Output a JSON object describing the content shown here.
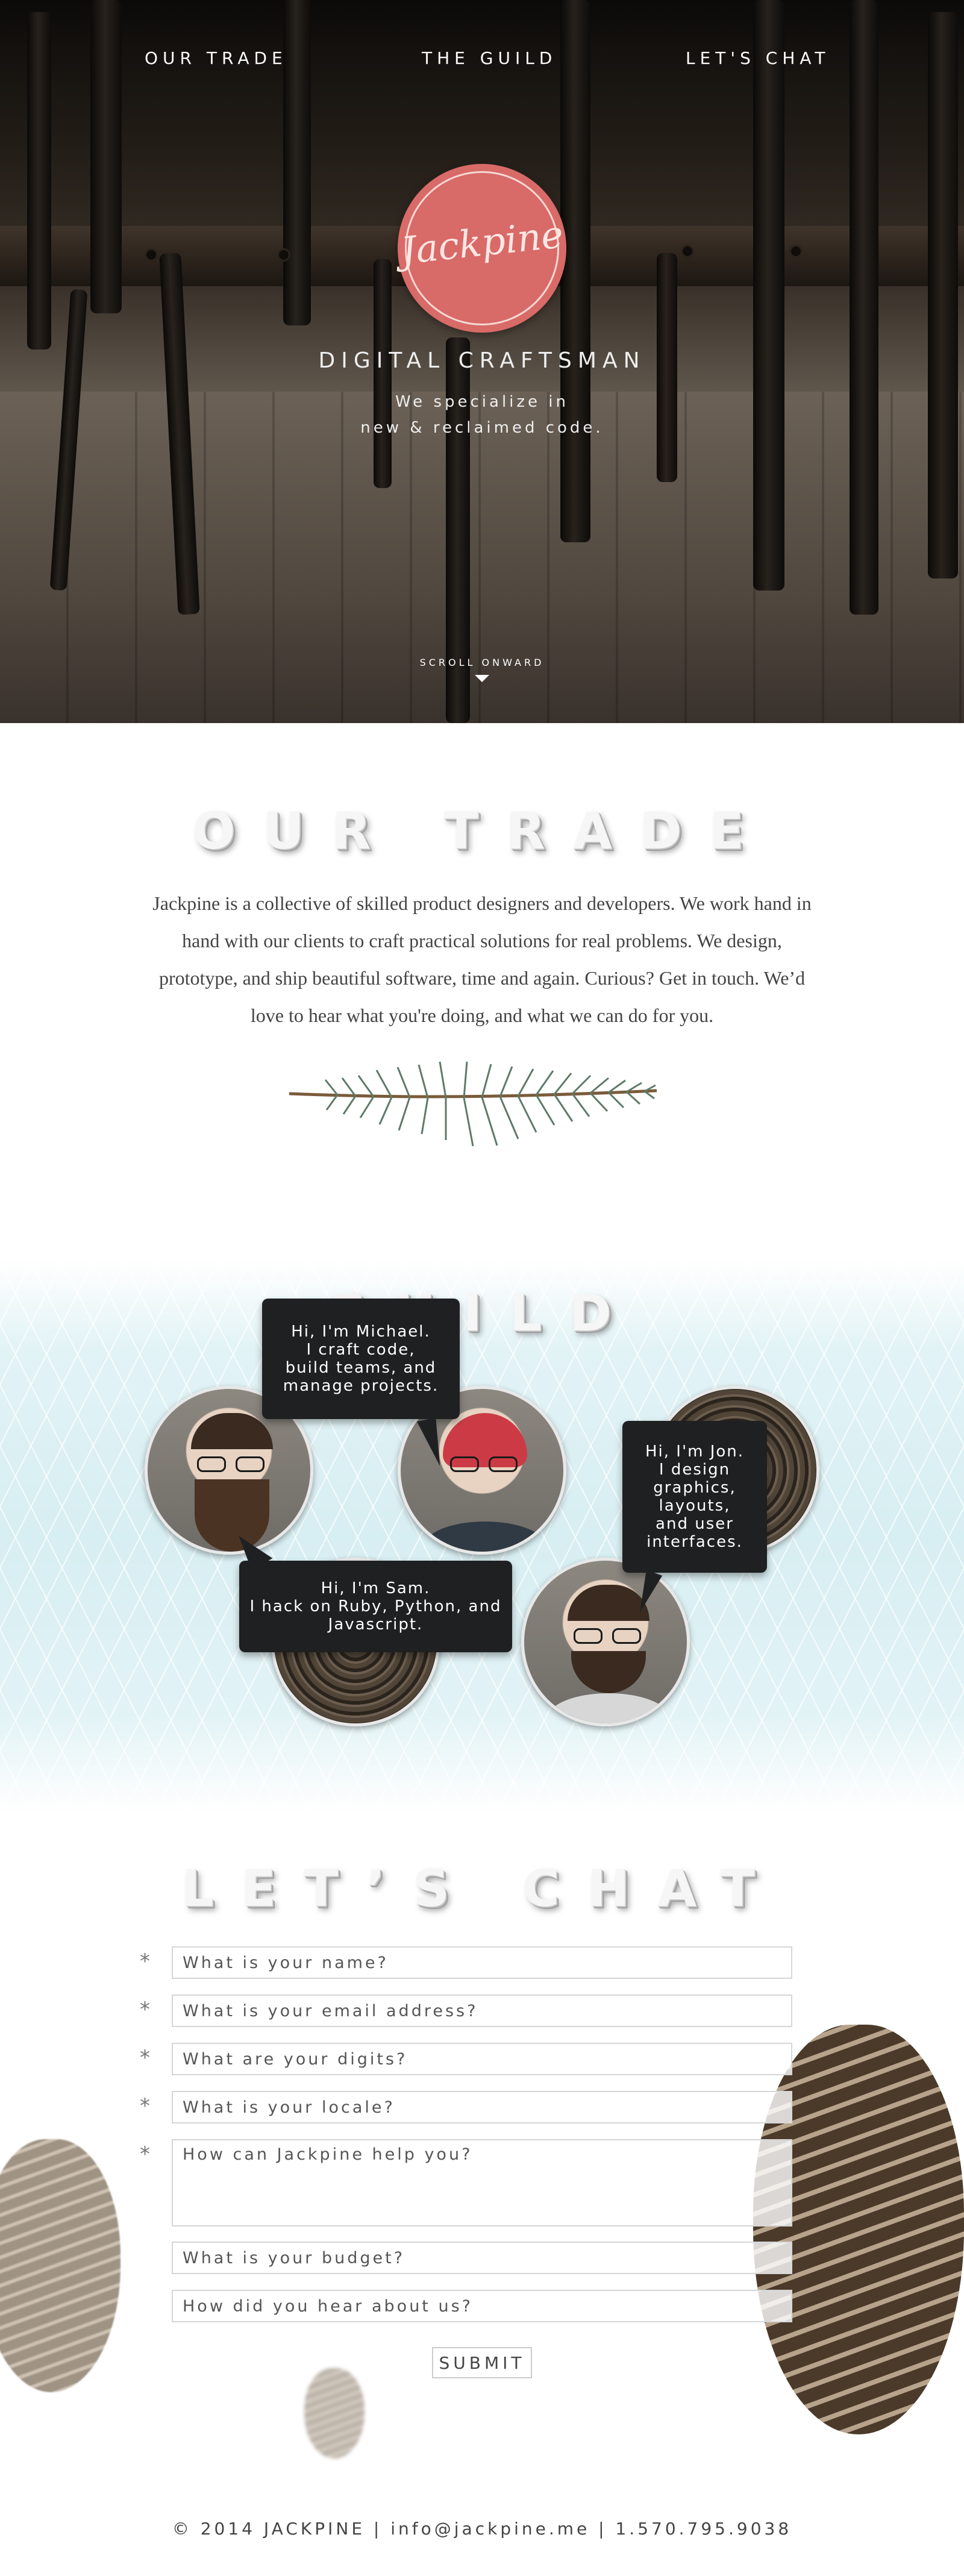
{
  "nav": {
    "trade": "OUR TRADE",
    "guild": "THE GUILD",
    "chat": "LET'S CHAT"
  },
  "hero": {
    "logo_text": "Jackpine",
    "tagline": "DIGITAL CRAFTSMAN",
    "sub_line1": "We specialize in",
    "sub_line2": "new & reclaimed code.",
    "scroll": "SCROLL ONWARD"
  },
  "trade": {
    "heading": "OUR TRADE",
    "body": "Jackpine is a collective of skilled product designers and developers. We work hand in hand with our clients to craft practical solutions for real problems. We design, prototype, and ship beautiful software, time and again. Curious? Get in touch. We’d love to hear what you're doing, and what we can do for you."
  },
  "guild": {
    "heading": "GUILD",
    "michael": "Hi, I'm Michael.\nI craft code,\nbuild teams, and\nmanage projects.",
    "jon": "Hi, I'm Jon.\nI design\ngraphics,\nlayouts,\nand user\ninterfaces.",
    "sam": "Hi, I'm Sam.\nI hack on Ruby, Python, and\nJavascript."
  },
  "chat": {
    "heading": "LET’S CHAT",
    "required_mark": "*",
    "name_placeholder": "What is your name?",
    "email_placeholder": "What is your email address?",
    "digits_placeholder": "What are your digits?",
    "locale_placeholder": "What is your locale?",
    "help_placeholder": "How can Jackpine help you?",
    "budget_placeholder": "What is your budget?",
    "hear_placeholder": "How did you hear about us?",
    "submit": "SUBMIT"
  },
  "footer": {
    "text": "© 2014 JACKPINE  |  info@jackpine.me  |  1.570.795.9038"
  },
  "colors": {
    "logo": "#d86a68",
    "bubble": "#1f2022",
    "guild_bg": "#d7eef2"
  }
}
